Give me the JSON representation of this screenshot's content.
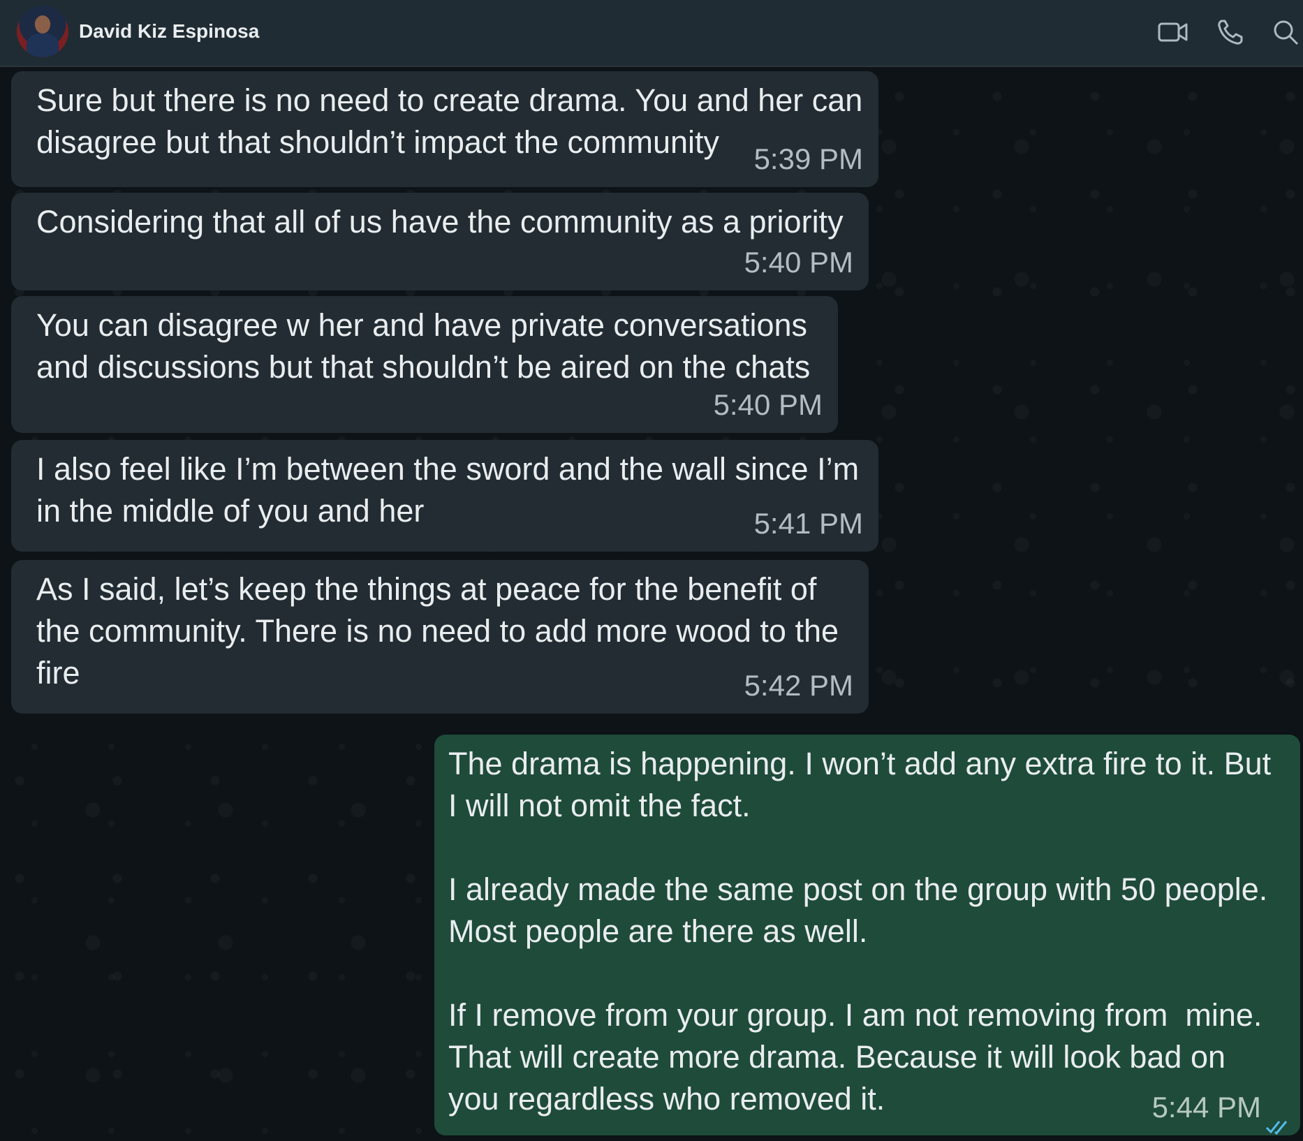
{
  "header": {
    "contact_name": "David Kiz Espinosa",
    "icons": [
      "video-call-icon",
      "voice-call-icon",
      "search-icon"
    ]
  },
  "messages": [
    {
      "direction": "in",
      "text": "Sure but there is no need to create drama. You and her can\ndisagree but that shouldn’t impact the community",
      "time": "5:39 PM"
    },
    {
      "direction": "in",
      "text": "Considering that all of us have the community as a priority",
      "time": "5:40 PM"
    },
    {
      "direction": "in",
      "text": "You can disagree w her and have private conversations\nand discussions but that shouldn’t be aired on the chats",
      "time": "5:40 PM"
    },
    {
      "direction": "in",
      "text": "I also feel like I’m between the sword and the wall since I’m\nin the middle of you and her",
      "time": "5:41 PM"
    },
    {
      "direction": "in",
      "text": "As I said, let’s keep the things at peace for the benefit of\nthe community. There is no need to add more wood to the\nfire",
      "time": "5:42 PM"
    },
    {
      "direction": "out",
      "text": "The drama is happening. I won’t add any extra fire to it. But\nI will not omit the fact.\n\nI already made the same post on the group with 50 people.\nMost people are there as well.\n\nIf I remove from your group. I am not removing from  mine.\nThat will create more drama. Because it will look bad on\nyou regardless who removed it.",
      "time": "5:44 PM",
      "status": "read-double-check"
    }
  ],
  "colors": {
    "header_bg": "#202c33",
    "incoming_bubble": "#222c32",
    "outgoing_bubble": "#1f4b3a",
    "read_ticks": "#53bdeb"
  }
}
